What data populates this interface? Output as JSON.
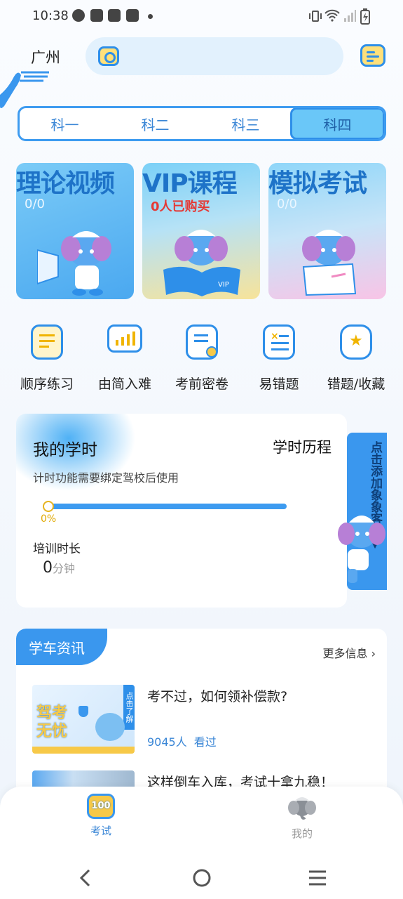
{
  "status_bar": {
    "time": "10:38",
    "icons": [
      "compass-icon",
      "bag-icon",
      "bag-icon",
      "bag-icon",
      "dot-icon"
    ],
    "right_icons": [
      "vibrate-icon",
      "wifi-icon",
      "signal-icon",
      "battery-icon"
    ]
  },
  "header": {
    "city": "广州",
    "search_placeholder": ""
  },
  "subject_tabs": [
    {
      "label": "科一",
      "active": false
    },
    {
      "label": "科二",
      "active": false
    },
    {
      "label": "科三",
      "active": false
    },
    {
      "label": "科四",
      "active": true
    }
  ],
  "feature_cards": [
    {
      "title": "理论视频",
      "subtitle": "0/0",
      "colors": [
        "#7bcbf7",
        "#4aa8f0"
      ]
    },
    {
      "title": "VIP课程",
      "subtitle": "0人已购买",
      "colors": [
        "#7bd0f7",
        "#f7e39a"
      ]
    },
    {
      "title": "模拟考试",
      "subtitle": "0/0",
      "colors": [
        "#8fd6f9",
        "#f8c4e6"
      ]
    }
  ],
  "quick_actions": [
    {
      "label": "顺序练习",
      "icon": "list-doc-icon"
    },
    {
      "label": "由简入难",
      "icon": "bar-chart-icon"
    },
    {
      "label": "考前密卷",
      "icon": "secret-paper-icon"
    },
    {
      "label": "易错题",
      "icon": "error-list-icon"
    },
    {
      "label": "错题/收藏",
      "icon": "star-badge-icon"
    }
  ],
  "study_time": {
    "title": "我的学时",
    "history_link": "学时历程",
    "note": "计时功能需要绑定驾校后使用",
    "progress_percent": 0,
    "progress_label": "0%",
    "training_label": "培训时长",
    "training_value": "0",
    "training_unit": "分钟"
  },
  "customer_service": {
    "text": "点击添加象象客服▼"
  },
  "news": {
    "header": "学车资讯",
    "more": "更多信息",
    "items": [
      {
        "title": "考不过，如何领补偿款?",
        "views": "9045人",
        "seen_label": "看过",
        "thumb_text": "驾考无忧",
        "thumb_tag": "点击了解"
      },
      {
        "title": "这样倒车入库，考试十拿九稳！",
        "views": "",
        "seen_label": ""
      }
    ]
  },
  "bottom_nav": [
    {
      "label": "考试",
      "icon": "exam-100-icon",
      "active": true
    },
    {
      "label": "我的",
      "icon": "elephant-avatar-icon",
      "active": false
    }
  ],
  "colors": {
    "primary": "#3a97ee",
    "accent_yellow": "#f7c948",
    "active_nav": "#3a86d6",
    "inactive_nav": "#999999"
  }
}
